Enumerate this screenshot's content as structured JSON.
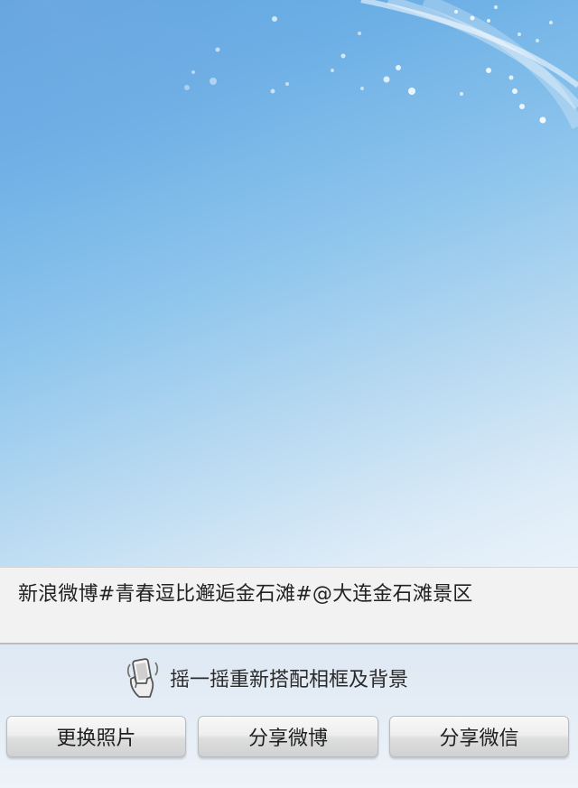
{
  "caption": {
    "text": "新浪微博#青春逗比邂逅金石滩#@大连金石滩景区"
  },
  "shake_hint": {
    "icon": "phone-shake-icon",
    "label": "摇一摇重新搭配相框及背景"
  },
  "buttons": {
    "change_photo": "更换照片",
    "share_weibo": "分享微博",
    "share_wechat": "分享微信"
  },
  "colors": {
    "sky_top": "#5aa3e0",
    "sky_bottom": "#e9f2fa",
    "caption_bg": "#f3f2f2",
    "button_face": "#e6e6e6",
    "text": "#222222"
  }
}
